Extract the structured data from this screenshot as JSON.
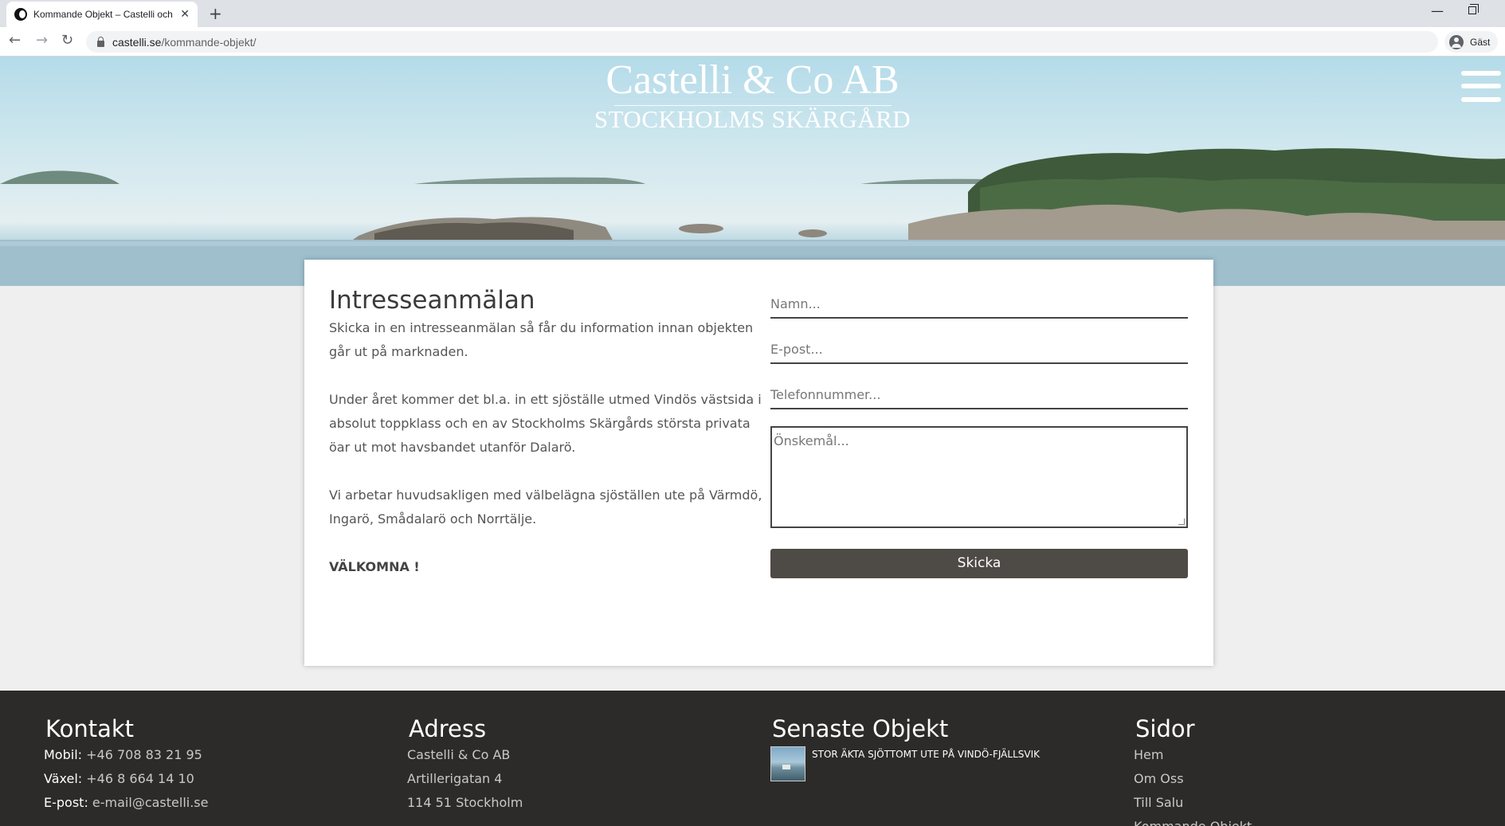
{
  "browser": {
    "tab_title": "Kommande Objekt – Castelli och",
    "close_glyph": "✕",
    "new_tab_glyph": "+",
    "url_host": "castelli.se",
    "url_path": "/kommande-objekt/",
    "profile_label": "Gäst"
  },
  "site": {
    "name": "Castelli & Co AB",
    "tagline": "STOCKHOLMS SKÄRGÅRD"
  },
  "intro": {
    "heading": "Intresseanmälan",
    "paragraph_1": "Skicka in en intresseanmälan så får du information innan objekten går ut på marknaden.",
    "paragraph_2": "Under året kommer det bl.a. in ett sjöställe utmed Vindös västsida i absolut toppklass och en av Stockholms Skärgårds största privata öar ut mot havsbandet utanför Dalarö.",
    "paragraph_3": "Vi arbetar huvudsakligen med välbelägna sjöställen ute på Värmdö, Ingarö, Smådalarö och Norrtälje.",
    "welcome": "VÄLKOMNA !"
  },
  "form": {
    "name_placeholder": "Namn...",
    "email_placeholder": "E-post...",
    "phone_placeholder": "Telefonnummer...",
    "wish_placeholder": "Önskemål...",
    "submit_label": "Skicka"
  },
  "footer": {
    "contact": {
      "heading": "Kontakt",
      "mobile_label": "Mobil:",
      "mobile_value": "+46 708 83 21 95",
      "switch_label": "Växel:",
      "switch_value": "+46 8 664 14 10",
      "email_label": "E-post:",
      "email_value": "e-mail@castelli.se"
    },
    "address": {
      "heading": "Adress",
      "line_1": "Castelli & Co AB",
      "line_2": "Artillerigatan 4",
      "line_3": "114 51 Stockholm"
    },
    "latest": {
      "heading": "Senaste Objekt",
      "post_title": "STOR ÄKTA SJÖTTOMT UTE PÅ VINDÖ-FJÄLLSVIK"
    },
    "pages": {
      "heading": "Sidor",
      "items": [
        "Hem",
        "Om Oss",
        "Till Salu",
        "Kommande Objekt"
      ]
    }
  }
}
